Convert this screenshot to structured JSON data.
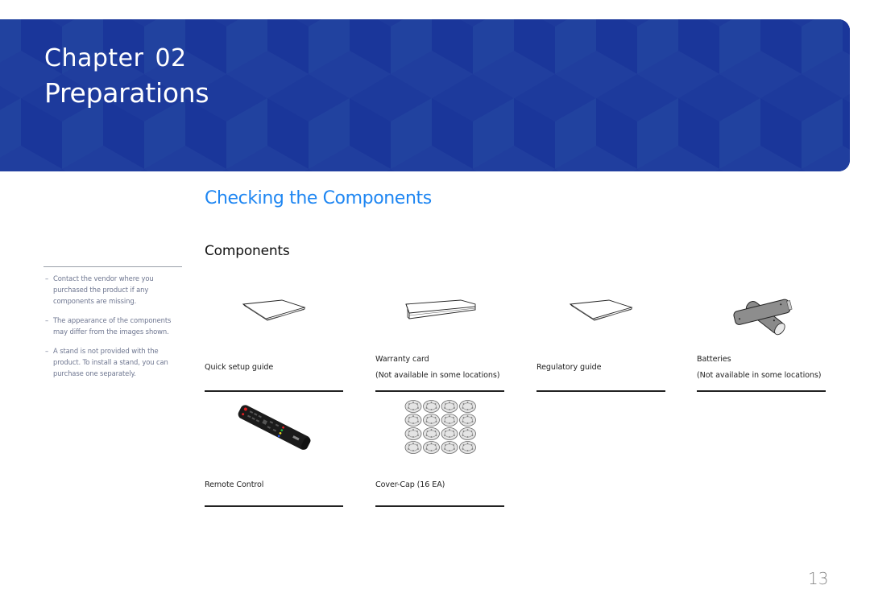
{
  "banner": {
    "chapter_word": "Chapter",
    "chapter_number": "02",
    "title": "Preparations",
    "background_color": "#1d3a9c"
  },
  "section": {
    "title": "Checking the Components",
    "title_color": "#1e86f2",
    "subtitle": "Components"
  },
  "sidebar": {
    "notes": [
      {
        "dash": "–",
        "text": "Contact the vendor where you purchased the product if any components are missing."
      },
      {
        "dash": "–",
        "text": "The appearance of the components may differ from the images shown."
      },
      {
        "dash": "–",
        "text": "A stand is not provided with the product. To install a stand, you can purchase one separately."
      }
    ]
  },
  "components": [
    {
      "name": "Quick setup guide",
      "note": "",
      "icon": "booklet-icon"
    },
    {
      "name": "Warranty card",
      "note": "(Not available in some locations)",
      "icon": "warranty-card-icon"
    },
    {
      "name": "Regulatory guide",
      "note": "",
      "icon": "booklet-icon"
    },
    {
      "name": "Batteries",
      "note": "(Not available in some locations)",
      "icon": "batteries-icon"
    },
    {
      "name": "Remote Control",
      "note": "",
      "icon": "remote-control-icon"
    },
    {
      "name": "Cover-Cap (16 EA)",
      "note": "",
      "icon": "cover-cap-icon"
    }
  ],
  "page_number": "13"
}
